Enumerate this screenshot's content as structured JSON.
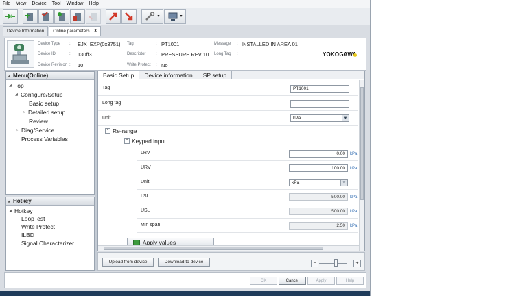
{
  "menu": [
    "File",
    "View",
    "Device",
    "Tool",
    "Window",
    "Help"
  ],
  "toolbar": {
    "icons": [
      "connect-icon",
      "add-device-icon",
      "device-check-icon",
      "device-settings-icon",
      "device-save-icon",
      "device-disabled-icon",
      "upload-icon",
      "download-icon",
      "wrench-icon",
      "monitor-icon"
    ]
  },
  "doc_tabs": [
    {
      "label": "Device Information",
      "active": false
    },
    {
      "label": "Online parameters",
      "active": true,
      "close": "X"
    }
  ],
  "device": {
    "type_label": "Device Type",
    "type_value": "EJX_EXP(0x3751)",
    "id_label": "Device ID",
    "id_value": "130ff3",
    "rev_label": "Device Revision",
    "rev_value": "10",
    "tag_label": "Tag",
    "tag_value": "PT1001",
    "desc_label": "Descriptor",
    "desc_value": "PRESSURE REV 10",
    "wp_label": "Write Protect",
    "wp_value": "No",
    "msg_label": "Message",
    "msg_value": "INSTALLED IN AREA 01",
    "longtag_label": "Long Tag",
    "longtag_value": "",
    "brand": "YOKOGAWA",
    "brand_color": "#e8c91a"
  },
  "menu_pane": {
    "title": "Menu(Online)",
    "items": [
      "Top",
      "Configure/Setup",
      "Basic setup",
      "Detailed setup",
      "Review",
      "Diag/Service",
      "Process Variables"
    ]
  },
  "hotkey_pane": {
    "title": "Hotkey",
    "items": [
      "Hotkey",
      "LoopTest",
      "Write Protect",
      "ILBD",
      "Signal Characterizer"
    ]
  },
  "subtabs": [
    "Basic Setup",
    "Device information",
    "SP setup"
  ],
  "form": {
    "tag_label": "Tag",
    "tag_value": "PT1001",
    "longtag_label": "Long tag",
    "longtag_value": "",
    "unit_label": "Unit",
    "unit_value": "kPa",
    "rerange_label": "Re-range",
    "keypad_label": "Keypad input",
    "lrv_label": "LRV",
    "lrv_value": "0.00",
    "lrv_unit": "kPa",
    "urv_label": "URV",
    "urv_value": "100.00",
    "urv_unit": "kPa",
    "unit2_label": "Unit",
    "unit2_value": "kPa",
    "lsl_label": "LSL",
    "lsl_value": "-500.00",
    "lsl_unit": "kPa",
    "usl_label": "USL",
    "usl_value": "500.00",
    "usl_unit": "kPa",
    "minspan_label": "Min span",
    "minspan_value": "2.50",
    "minspan_unit": "kPa",
    "apply_label": "Apply values"
  },
  "bottom": {
    "upload_label": "Upload from device",
    "download_label": "Download to device"
  },
  "footer": {
    "ok": "OK",
    "cancel": "Cancel",
    "apply": "Apply",
    "help": "Help"
  }
}
